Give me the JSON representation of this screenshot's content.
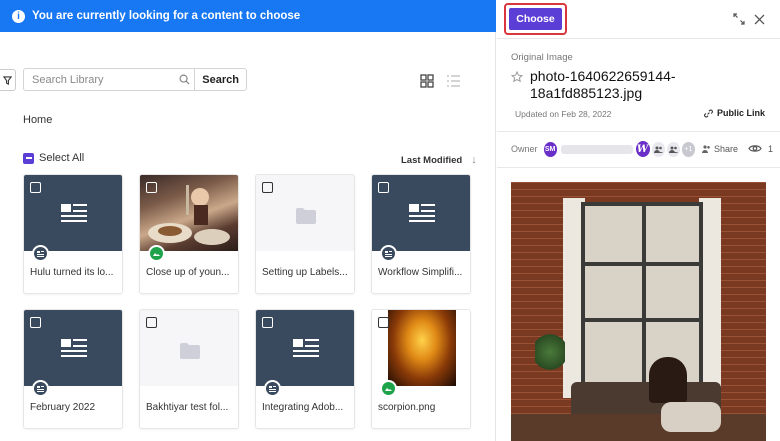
{
  "banner": {
    "text": "You are currently looking for a content to choose"
  },
  "search": {
    "placeholder": "Search Library",
    "button_label": "Search"
  },
  "breadcrumb": {
    "home": "Home"
  },
  "select_all": {
    "label": "Select All"
  },
  "sort": {
    "label": "Last Modified"
  },
  "cards": [
    {
      "name": "Hulu turned its lo...",
      "kind": "doc"
    },
    {
      "name": "Close up of youn...",
      "kind": "image"
    },
    {
      "name": "Setting up Labels...",
      "kind": "folder"
    },
    {
      "name": "Workflow Simplifi...",
      "kind": "doc"
    },
    {
      "name": "February 2022",
      "kind": "doc"
    },
    {
      "name": "Bakhtiyar test fol...",
      "kind": "folder"
    },
    {
      "name": "Integrating Adob...",
      "kind": "doc"
    },
    {
      "name": "scorpion.png",
      "kind": "image"
    }
  ],
  "panel": {
    "choose_label": "Choose",
    "section_label": "Original Image",
    "file_name": "photo-1640622659144-18a1fd885123.jpg",
    "updated": "Updated on Feb 28, 2022",
    "public_link": "Public Link",
    "owner_label": "Owner",
    "owner_initials": "SM",
    "collaborator_initial": "W",
    "extra_count": "+1",
    "share_label": "Share",
    "views": "1"
  },
  "colors": {
    "accent": "#5b3ed6",
    "banner": "#1877f2",
    "highlight": "#d9363e",
    "doc_tile": "#3a4a5e",
    "image_badge": "#1ea34a"
  }
}
